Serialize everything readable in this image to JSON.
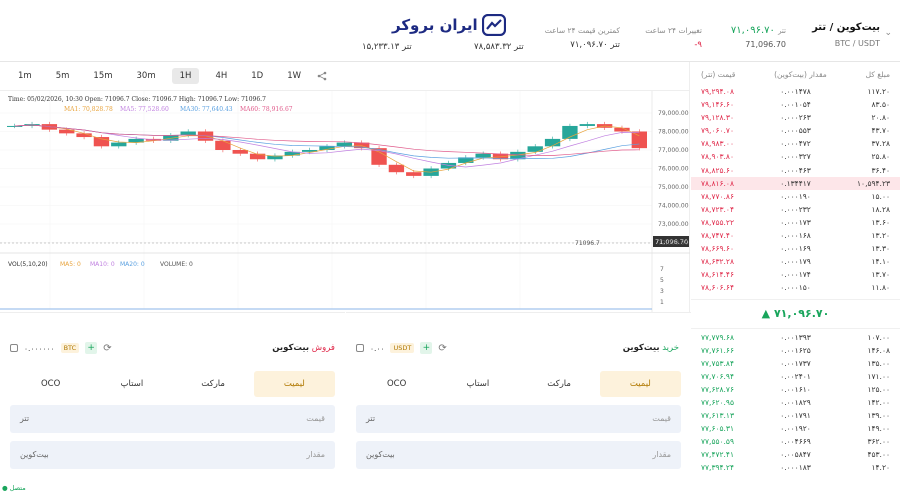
{
  "header": {
    "brand": "ایران بروکر",
    "pair_title": "بیت‌کوین / تتر",
    "pair_symbol": "BTC / USDT",
    "stats": [
      {
        "label": "تتر",
        "value": "۷۱,۰۹۶.۷۰",
        "sub": "71,096.70"
      },
      {
        "label": "تغییرات ۲۴ ساعت",
        "value": "-۹"
      },
      {
        "label": "کمترین قیمت ۲۴ ساعت",
        "value": "۷۱,۰۹۶.۷۰ تتر"
      },
      {
        "label": "",
        "value": "۷۸,۵۸۳.۳۲ تتر"
      },
      {
        "label": "",
        "value": "۱۵,۲۳۳.۱۳ تتر"
      }
    ]
  },
  "chart": {
    "timeframes": [
      "1m",
      "5m",
      "15m",
      "30m",
      "1H",
      "4H",
      "1D",
      "1W"
    ],
    "active_timeframe": "1H",
    "ohlc_label": "Time: 05/02/2026, 10:30    Open: 71096.7    Close: 71096.7    High: 71096.7    Low: 71096.7",
    "ma_labels": [
      "MA1: 70,828.78",
      "MA5: 77,528.60",
      "MA30: 77,640.43",
      "MA60: 78,916.67"
    ],
    "vol_label": "VOL(5,10,20)",
    "vol_ma": [
      "MA5: 0",
      "MA10: 0",
      "MA20: 0",
      "VOLUME: 0"
    ],
    "current_price_tag": "71,096.70",
    "last_label": "71096.7",
    "y_ticks": [
      "79,000.00",
      "78,000.00",
      "77,000.00",
      "76,000.00",
      "75,000.00",
      "74,000.00",
      "73,000.00",
      "72,000.00"
    ],
    "vol_ticks": [
      "7",
      "5",
      "3",
      "1"
    ],
    "x_ticks": [
      "04-27",
      "04-28",
      "04-29",
      "23:30",
      "04-30",
      "2026-05"
    ],
    "colors": {
      "up": "#26a69a",
      "down": "#ef5350"
    }
  },
  "orderbook": {
    "headers": [
      "مبلغ کل",
      "مقدار (بیت‌کوین)",
      "قیمت (تتر)"
    ],
    "asks": [
      {
        "p": "۷۹,۲۹۴.۰۸",
        "q": "۰.۰۰۱۴۷۸",
        "t": "۱۱۷.۲۰"
      },
      {
        "p": "۷۹,۱۴۶.۶۰",
        "q": "۰.۰۰۱۰۵۴",
        "t": "۸۳.۵۰"
      },
      {
        "p": "۷۹,۱۲۸.۳۰",
        "q": "۰.۰۰۰۲۶۳",
        "t": "۲۰.۸۰"
      },
      {
        "p": "۷۹,۰۶۰.۷۰",
        "q": "۰.۰۰۰۵۵۳",
        "t": "۴۳.۷۰"
      },
      {
        "p": "۷۸,۹۸۳.۰۰",
        "q": "۰.۰۰۰۴۷۲",
        "t": "۳۷.۲۸"
      },
      {
        "p": "۷۸,۹۰۳.۸۰",
        "q": "۰.۰۰۰۳۲۷",
        "t": "۲۵.۸۰"
      },
      {
        "p": "۷۸,۸۲۵.۶۰",
        "q": "۰.۰۰۰۴۶۳",
        "t": "۳۶.۴۰"
      },
      {
        "p": "۷۸,۸۱۶.۰۸",
        "q": "۰.۱۳۴۴۱۷",
        "t": "۱۰,۵۹۴.۲۳",
        "hl": true
      },
      {
        "p": "۷۸,۷۷۰.۸۶",
        "q": "۰.۰۰۰۱۹۰",
        "t": "۱۵.۰۰"
      },
      {
        "p": "۷۸,۷۲۳.۰۴",
        "q": "۰.۰۰۰۲۳۲",
        "t": "۱۸.۲۸"
      },
      {
        "p": "۷۸,۷۵۵.۲۲",
        "q": "۰.۰۰۰۱۷۳",
        "t": "۱۳.۶۰"
      },
      {
        "p": "۷۸,۷۴۷.۴۰",
        "q": "۰.۰۰۰۱۶۸",
        "t": "۱۳.۲۰"
      },
      {
        "p": "۷۸,۶۶۹.۶۰",
        "q": "۰.۰۰۰۱۶۹",
        "t": "۱۳.۳۰"
      },
      {
        "p": "۷۸,۶۳۲.۲۸",
        "q": "۰.۰۰۰۱۷۹",
        "t": "۱۴.۱۰"
      },
      {
        "p": "۷۸,۶۱۴.۴۶",
        "q": "۰.۰۰۰۱۷۴",
        "t": "۱۳.۷۰"
      },
      {
        "p": "۷۸,۶۰۶.۶۴",
        "q": "۰.۰۰۰۱۵۰",
        "t": "۱۱.۸۰"
      }
    ],
    "mid_price": "▲ ۷۱,۰۹۶.۷۰",
    "bids": [
      {
        "p": "۷۷,۷۷۹.۶۸",
        "q": "۰.۰۰۱۳۹۳",
        "t": "۱۰۷.۰۰"
      },
      {
        "p": "۷۷,۷۶۱.۶۶",
        "q": "۰.۰۰۱۶۲۵",
        "t": "۱۴۶.۰۸"
      },
      {
        "p": "۷۷,۷۵۳.۸۴",
        "q": "۰.۰۰۱۷۳۷",
        "t": "۱۳۵.۰۰"
      },
      {
        "p": "۷۷,۷۰۶.۹۴",
        "q": "۰.۰۰۲۴۰۱",
        "t": "۱۷۱.۰۰"
      },
      {
        "p": "۷۷,۶۲۸.۷۶",
        "q": "۰.۰۰۱۶۱۰",
        "t": "۱۲۵.۰۰"
      },
      {
        "p": "۷۷,۶۲۰.۹۵",
        "q": "۰.۰۰۱۸۲۹",
        "t": "۱۴۲.۰۰"
      },
      {
        "p": "۷۷,۶۱۳.۱۳",
        "q": "۰.۰۰۱۷۹۱",
        "t": "۱۳۹.۰۰"
      },
      {
        "p": "۷۷,۶۰۵.۳۱",
        "q": "۰.۰۰۱۹۲۰",
        "t": "۱۴۹.۰۰"
      },
      {
        "p": "۷۷,۵۵۰.۵۹",
        "q": "۰.۰۰۴۶۶۹",
        "t": "۳۶۲.۰۰"
      },
      {
        "p": "۷۷,۴۷۲.۴۱",
        "q": "۰.۰۰۵۸۴۷",
        "t": "۴۵۳.۰۰"
      },
      {
        "p": "۷۷,۳۹۴.۲۴",
        "q": "۰.۰۰۰۱۸۳",
        "t": "۱۴.۲۰"
      }
    ]
  },
  "buy": {
    "title": "خرید",
    "asset": "بیت‌کوین",
    "balance": "۰.۰۰",
    "balance_unit": "USDT",
    "tabs": [
      "لیمیت",
      "مارکت",
      "استاپ",
      "OCO"
    ],
    "price_label": "قیمت",
    "price_unit": "تتر",
    "amount_label": "مقدار",
    "amount_unit": "بیت‌کوین"
  },
  "sell": {
    "title": "فروش",
    "asset": "بیت‌کوین",
    "balance": "۰.۰۰۰۰۰۰",
    "balance_unit": "BTC",
    "tabs": [
      "لیمیت",
      "مارکت",
      "استاپ",
      "OCO"
    ],
    "price_label": "قیمت",
    "price_unit": "تتر",
    "amount_label": "مقدار",
    "amount_unit": "بیت‌کوین"
  },
  "status": "● متصل",
  "chart_data": {
    "type": "candlestick",
    "series": [
      {
        "values": [
          78.3,
          78.4,
          78.1,
          77.9,
          77.7,
          77.2,
          77.4,
          77.6,
          77.5,
          77.8,
          78.0,
          77.5,
          77.0,
          76.8,
          76.5,
          76.7,
          76.9,
          77.0,
          77.2,
          77.4,
          77.1,
          76.2,
          75.8,
          75.6,
          76.0,
          76.3,
          76.6,
          76.8,
          76.5,
          76.9,
          77.2,
          77.6,
          78.3,
          78.4,
          78.2,
          78.0,
          77.1
        ]
      }
    ],
    "ylim": [
      71000,
      79500
    ]
  }
}
